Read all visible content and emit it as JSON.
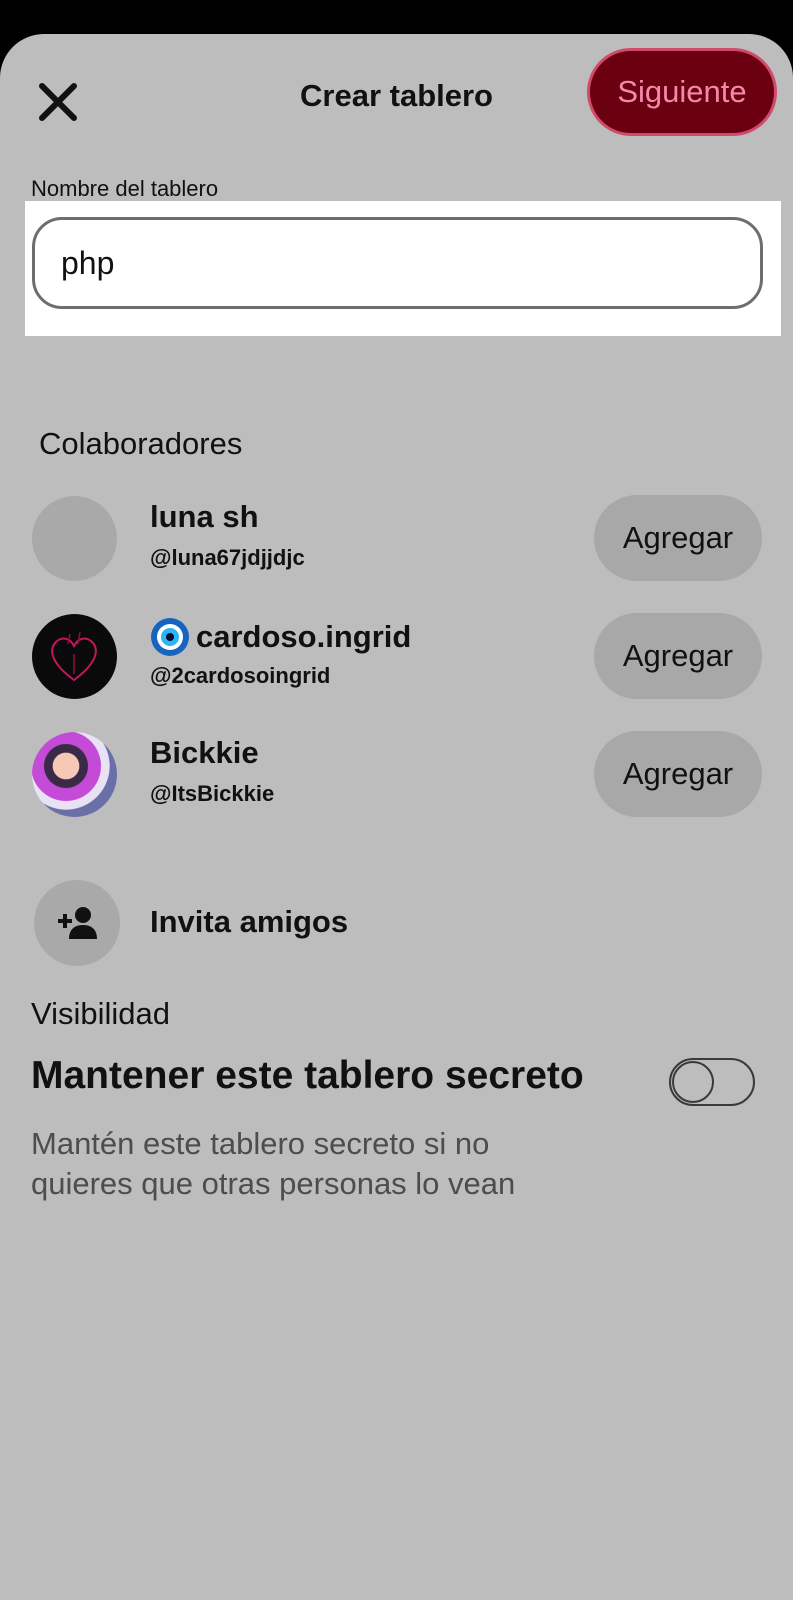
{
  "header": {
    "title": "Crear tablero",
    "next_label": "Siguiente"
  },
  "board_name": {
    "label": "Nombre del tablero",
    "value": "php"
  },
  "collaborators": {
    "title": "Colaboradores",
    "add_label": "Agregar",
    "items": [
      {
        "name": "luna sh",
        "handle": "@luna67jdjjdjc"
      },
      {
        "name": "cardoso.ingrid",
        "handle": "@2cardosoingrid"
      },
      {
        "name": "Bickkie",
        "handle": "@ItsBickkie"
      }
    ],
    "invite_label": "Invita amigos"
  },
  "visibility": {
    "title": "Visibilidad",
    "secret_label": "Mantener este tablero secreto",
    "secret_description": "Mantén este tablero secreto si no quieres que otras personas lo vean",
    "secret_enabled": false
  },
  "colors": {
    "sheet_background": "#bdbdbd",
    "primary_button": "#6b0011",
    "primary_button_text": "#f08aa8",
    "secondary_button": "#a8a8a8"
  },
  "icons": {
    "close": "close-icon",
    "invite": "add-person-icon",
    "name_badge": "evil-eye-icon"
  }
}
